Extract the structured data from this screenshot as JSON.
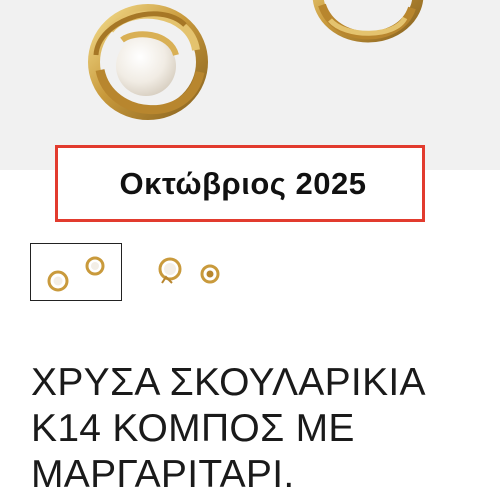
{
  "gallery": {
    "main_image_icon": "pearl-knot-earrings-image",
    "thumbnails": [
      {
        "icon": "earrings-pair-thumbnail",
        "selected": true
      },
      {
        "icon": "earrings-pearl-thumbnail",
        "selected": false
      }
    ]
  },
  "banner": {
    "date_text": "Οκτώβριος 2025",
    "border_color": "#e23b2e"
  },
  "product": {
    "title": "ΧΡΥΣΑ ΣΚΟΥΛΑΡΙΚΙΑ Κ14 ΚΟΜΠΟΣ ΜΕ ΜΑΡΓΑΡΙΤΑΡΙ."
  }
}
